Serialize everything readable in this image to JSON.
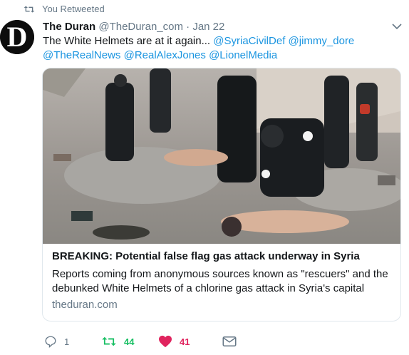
{
  "retweet_context": {
    "text": "You Retweeted"
  },
  "tweet": {
    "author_name": "The Duran",
    "author_handle": "@TheDuran_com",
    "separator": "·",
    "time": "Jan 22",
    "avatar_letter": "D",
    "text_lead": "The White Helmets are at it again...",
    "mentions": [
      "@SyriaCivilDef",
      "@jimmy_dore",
      "@TheRealNews",
      "@RealAlexJones",
      "@LionelMedia"
    ]
  },
  "card": {
    "title": "BREAKING: Potential false flag gas attack underway in Syria",
    "description": "Reports coming from anonymous sources known as \"rescuers\" and the debunked White Helmets of a chlorine gas attack in Syria's capital",
    "domain": "theduran.com"
  },
  "actions": {
    "reply_count": "1",
    "retweet_count": "44",
    "like_count": "41"
  },
  "colors": {
    "link": "#1b95e0",
    "retweet_active": "#17bf63",
    "like_active": "#e0245e",
    "secondary": "#657786"
  },
  "icons": {
    "retweet_context": "retweet-icon",
    "reply": "reply-icon",
    "retweet": "retweet-icon",
    "like": "heart-icon",
    "dm": "envelope-icon",
    "menu": "chevron-down-icon"
  }
}
